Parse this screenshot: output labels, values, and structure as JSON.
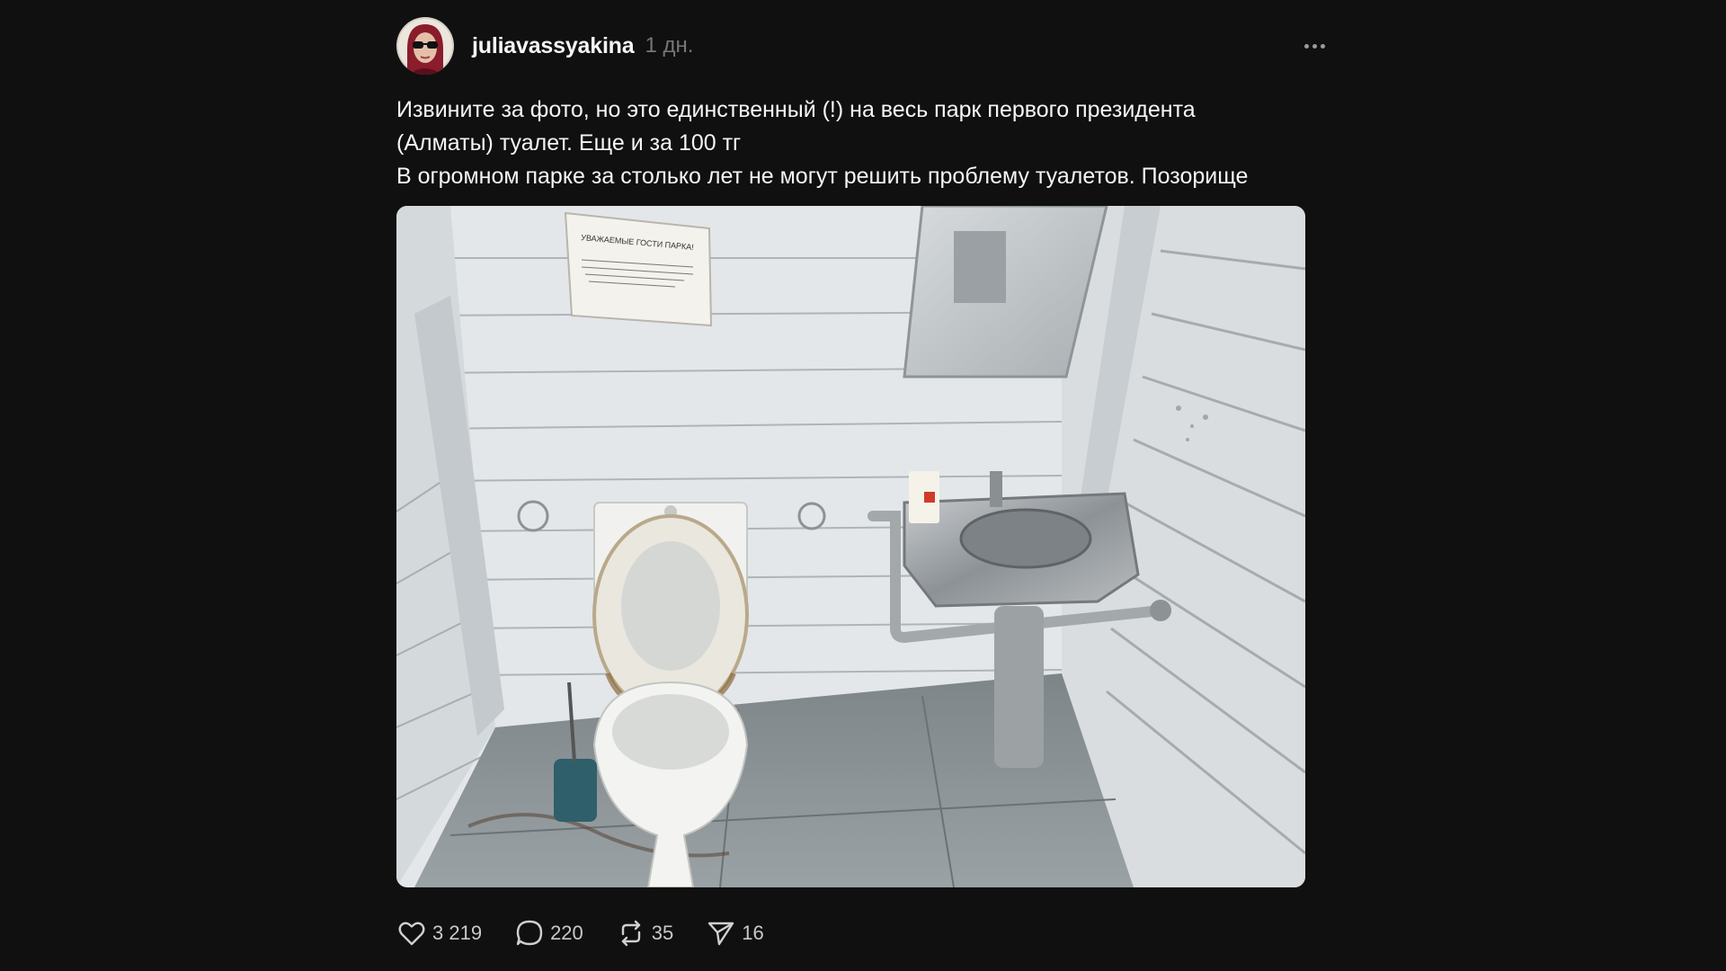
{
  "post": {
    "username": "juliavassyakina",
    "time": "1 дн.",
    "caption_lines": [
      "Извините за фото, но это единственный (!) на весь парк первого президента",
      "(Алматы) туалет. Еще и за 100 тг",
      "В огромном парке за столько лет не могут решить проблему туалетов. Позорище"
    ],
    "photo_sign": {
      "heading": "УВАЖАЕМЫЕ ГОСТИ ПАРКА!"
    }
  },
  "actions": {
    "likes": "3 219",
    "comments": "220",
    "reposts": "35",
    "shares": "16"
  },
  "icons": {
    "avatar": "avatar",
    "more": "more-dots-icon",
    "like": "heart-icon",
    "comment": "comment-bubble-icon",
    "repost": "repost-icon",
    "share": "send-icon"
  },
  "colors": {
    "background": "#101010",
    "text": "#f3f5f7",
    "muted": "#777777"
  }
}
